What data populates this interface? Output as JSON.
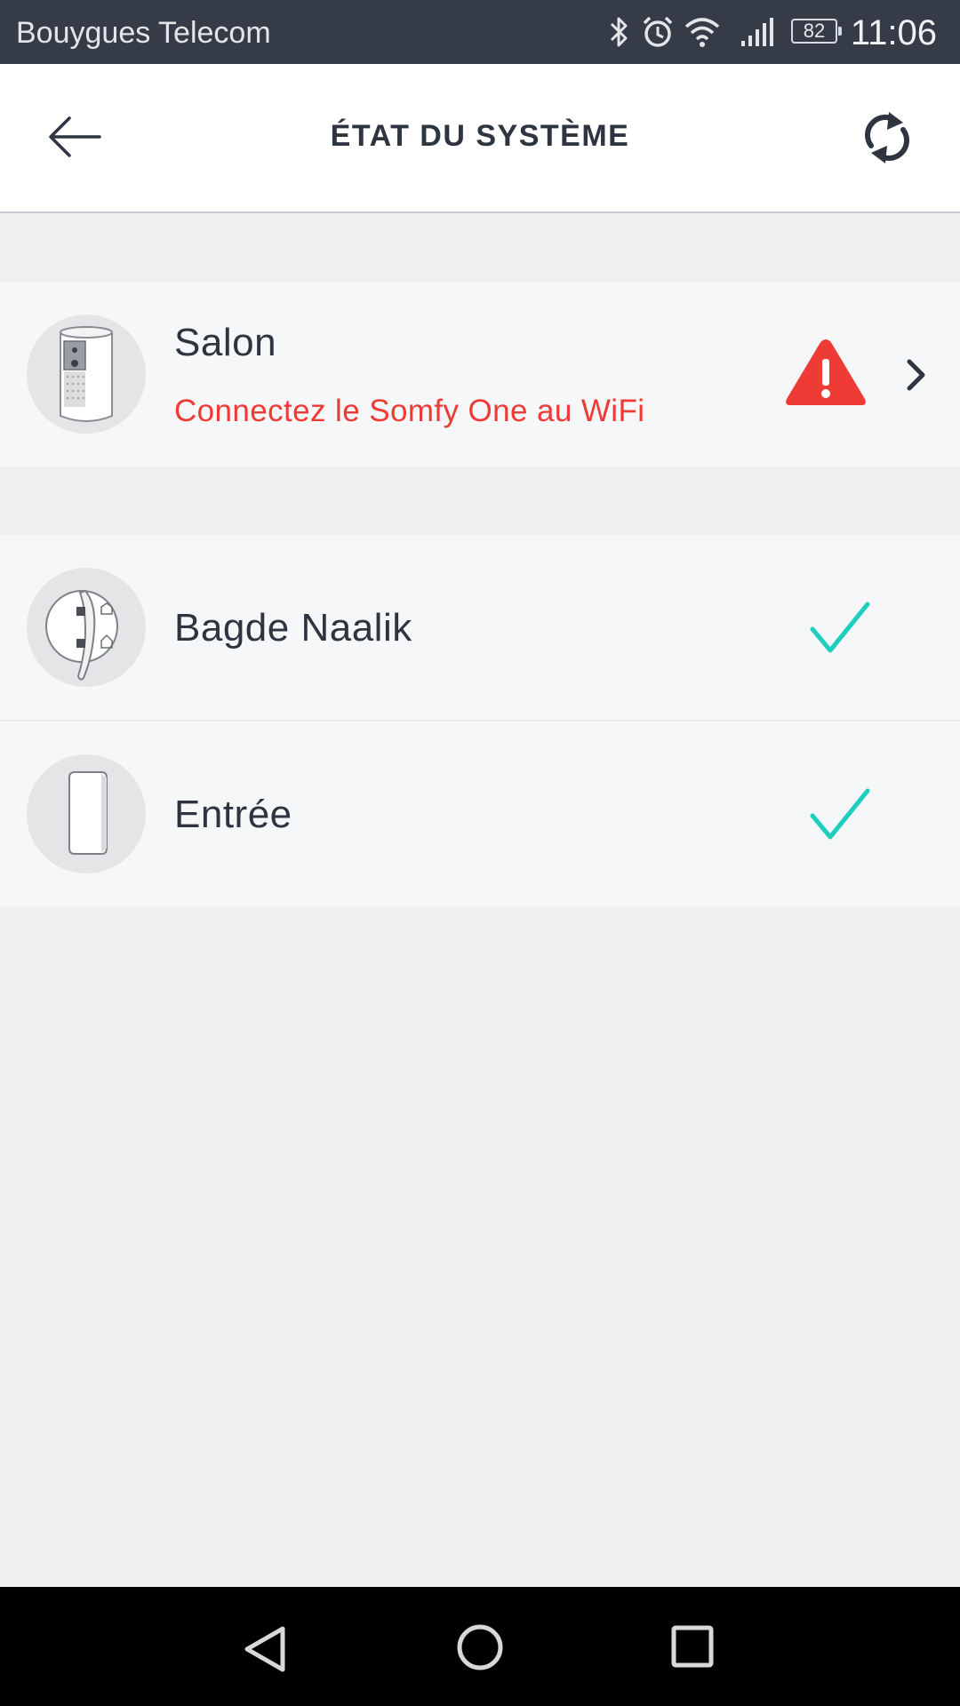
{
  "status_bar": {
    "carrier": "Bouygues Telecom",
    "battery": "82",
    "time": "11:06",
    "icons": [
      "bluetooth-icon",
      "alarm-icon",
      "wifi-icon",
      "signal-icon",
      "battery-icon"
    ]
  },
  "header": {
    "title": "ÉTAT DU SYSTÈME",
    "back_icon": "arrow-left-icon",
    "refresh_icon": "refresh-icon"
  },
  "devices": {
    "salon": {
      "name": "Salon",
      "message": "Connectez le Somfy One au WiFi",
      "status": "warning",
      "status_icon": "warning-triangle-icon"
    },
    "badge": {
      "name": "Bagde Naalik",
      "status": "ok",
      "status_icon": "check-icon"
    },
    "entree": {
      "name": "Entrée",
      "status": "ok",
      "status_icon": "check-icon"
    }
  },
  "colors": {
    "warning": "#ee3b35",
    "ok": "#1ecfbf",
    "text": "#2e3440",
    "status_bar": "#363c47",
    "background": "#eff0f2"
  },
  "nav_bar": [
    "back-nav-icon",
    "home-nav-icon",
    "recents-nav-icon"
  ]
}
